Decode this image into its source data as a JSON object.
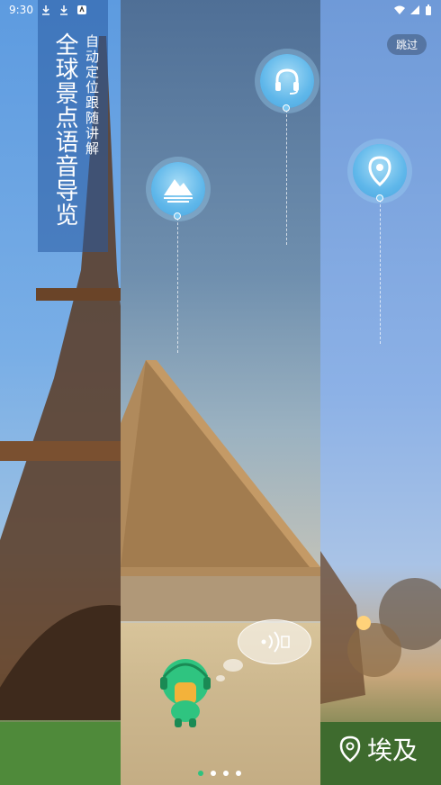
{
  "status_bar": {
    "time": "9:30"
  },
  "title": {
    "main": "全球景点语音导览",
    "subtitle": "自动定位跟随讲解"
  },
  "skip_label": "跳过",
  "location_label": "埃及",
  "pager": {
    "total": 4,
    "active_index": 0
  },
  "colors": {
    "pin_blue": "#5fb7ea",
    "active_dot": "#2ec27e",
    "mascot_green": "#2fc480",
    "title_bg": "#285aa0"
  },
  "icons": {
    "pin_left": "mountain-icon",
    "pin_center": "headset-icon",
    "pin_right": "location-pin-icon"
  }
}
